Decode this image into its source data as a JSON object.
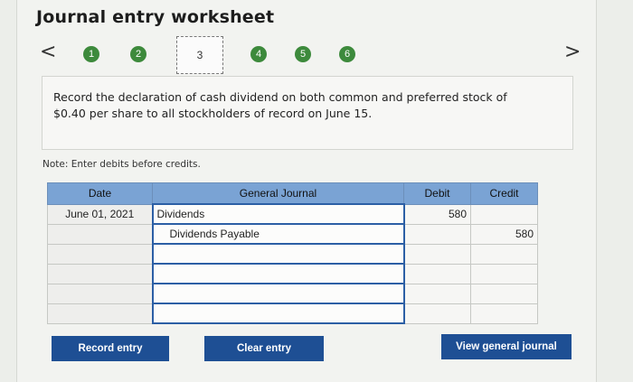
{
  "header": {
    "title": "Journal entry worksheet"
  },
  "nav": {
    "prev": "<",
    "next": ">",
    "steps": [
      "1",
      "2",
      "3",
      "4",
      "5",
      "6"
    ],
    "current_step": "3"
  },
  "instruction": "Record the declaration of cash dividend on both common and preferred stock of $0.40 per share to all stockholders of record on June 15.",
  "note": "Note: Enter debits before credits.",
  "journal": {
    "headers": {
      "date": "Date",
      "general_journal": "General Journal",
      "debit": "Debit",
      "credit": "Credit"
    },
    "rows": [
      {
        "date": "June 01, 2021",
        "account": "Dividends",
        "debit": "580",
        "credit": ""
      },
      {
        "date": "",
        "account": "Dividends Payable",
        "debit": "",
        "credit": "580"
      },
      {
        "date": "",
        "account": "",
        "debit": "",
        "credit": ""
      },
      {
        "date": "",
        "account": "",
        "debit": "",
        "credit": ""
      },
      {
        "date": "",
        "account": "",
        "debit": "",
        "credit": ""
      },
      {
        "date": "",
        "account": "",
        "debit": "",
        "credit": ""
      }
    ]
  },
  "buttons": {
    "record": "Record entry",
    "clear": "Clear entry",
    "view": "View general journal"
  },
  "colors": {
    "step_green": "#3d8a3c",
    "header_blue": "#7aa3d4",
    "button_blue": "#1e4f94"
  }
}
